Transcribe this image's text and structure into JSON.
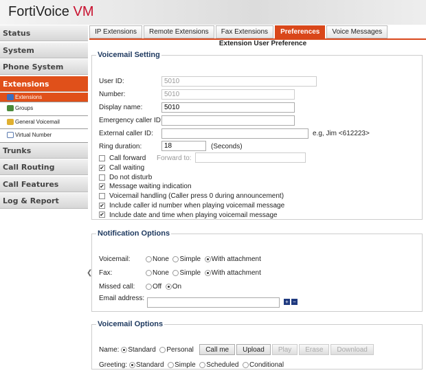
{
  "app": {
    "name": "FortiVoice",
    "suffix": "VM"
  },
  "sidebar": {
    "items": [
      "Status",
      "System",
      "Phone System",
      "Extensions",
      "Trunks",
      "Call Routing",
      "Call Features",
      "Log & Report"
    ],
    "sub": [
      "Extensions",
      "Groups",
      "General Voicemail",
      "Virtual Number"
    ]
  },
  "tabs": [
    "IP Extensions",
    "Remote Extensions",
    "Fax Extensions",
    "Preferences",
    "Voice Messages"
  ],
  "page_title": "Extension User Preference",
  "voicemail_setting": {
    "legend": "Voicemail Setting",
    "user_id_label": "User ID:",
    "user_id": "5010",
    "number_label": "Number:",
    "number": "5010",
    "display_name_label": "Display name:",
    "display_name": "5010",
    "emergency_label": "Emergency caller ID:",
    "emergency": "",
    "external_label": "External caller ID:",
    "external": "",
    "external_hint": "e.g, Jim <612223>",
    "ring_label": "Ring duration:",
    "ring": "18",
    "ring_unit": "(Seconds)",
    "call_forward": "Call forward",
    "forward_to": "Forward to:",
    "checks": [
      {
        "label": "Call waiting",
        "checked": true
      },
      {
        "label": "Do not disturb",
        "checked": false
      },
      {
        "label": "Message waiting indication",
        "checked": true
      },
      {
        "label": "Voicemail handling (Caller press 0 during announcement)",
        "checked": false
      },
      {
        "label": "Include caller id number when playing voicemail message",
        "checked": true
      },
      {
        "label": "Include date and time when playing voicemail message",
        "checked": true
      }
    ]
  },
  "notification": {
    "legend": "Notification Options",
    "voicemail_label": "Voicemail:",
    "fax_label": "Fax:",
    "opts": [
      "None",
      "Simple",
      "With attachment"
    ],
    "missed_label": "Missed call:",
    "missed_opts": [
      "Off",
      "On"
    ],
    "email_label": "Email address:",
    "email": "",
    "add": "+",
    "remove": "−"
  },
  "vm_options": {
    "legend": "Voicemail Options",
    "name_label": "Name:",
    "name_opts": [
      "Standard",
      "Personal"
    ],
    "buttons": [
      "Call me",
      "Upload",
      "Play",
      "Erase",
      "Download"
    ],
    "greeting_label": "Greeting:",
    "greeting_opts": [
      "Standard",
      "Simple",
      "Scheduled",
      "Conditional"
    ]
  }
}
